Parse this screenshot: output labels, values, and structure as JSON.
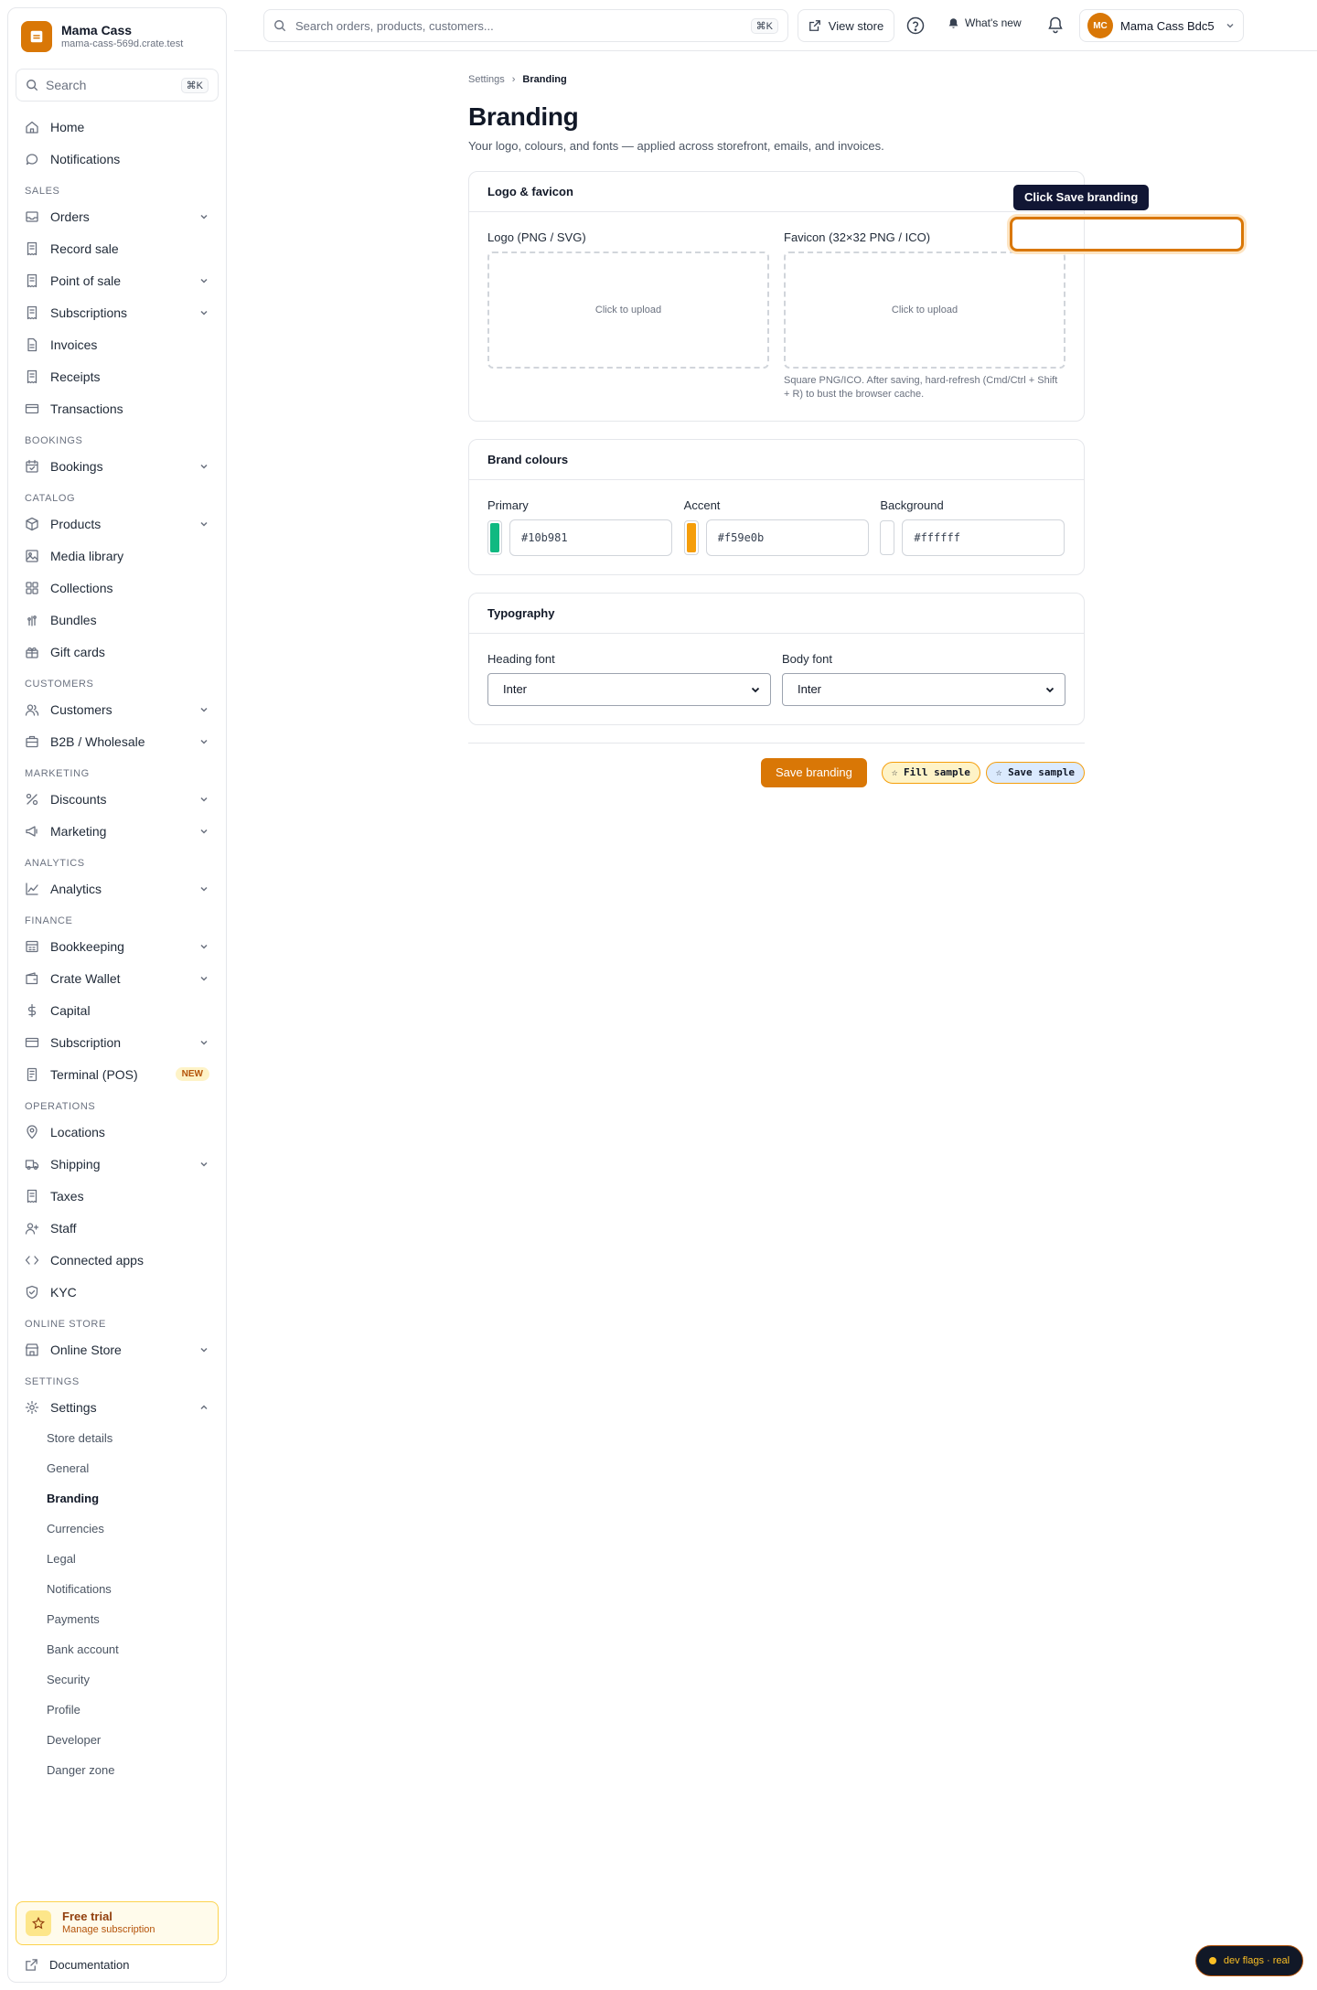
{
  "store": {
    "name": "Mama Cass",
    "domain": "mama-cass-569d.crate.test"
  },
  "sidebar": {
    "search_label": "Search",
    "search_shortcut": "⌘K",
    "top_items": [
      {
        "label": "Home",
        "icon": "home-icon"
      },
      {
        "label": "Notifications",
        "icon": "chat-bubble-icon"
      }
    ],
    "sections": [
      {
        "title": "SALES",
        "items": [
          {
            "label": "Orders",
            "icon": "inbox-icon",
            "expandable": true
          },
          {
            "label": "Record sale",
            "icon": "receipt-icon",
            "expandable": false
          },
          {
            "label": "Point of sale",
            "icon": "receipt-icon",
            "expandable": true
          },
          {
            "label": "Subscriptions",
            "icon": "receipt-icon",
            "expandable": true
          },
          {
            "label": "Invoices",
            "icon": "document-icon",
            "expandable": false
          },
          {
            "label": "Receipts",
            "icon": "receipt-icon",
            "expandable": false
          },
          {
            "label": "Transactions",
            "icon": "credit-card-icon",
            "expandable": false
          }
        ]
      },
      {
        "title": "BOOKINGS",
        "items": [
          {
            "label": "Bookings",
            "icon": "calendar-icon",
            "expandable": true
          }
        ]
      },
      {
        "title": "CATALOG",
        "items": [
          {
            "label": "Products",
            "icon": "box-icon",
            "expandable": true
          },
          {
            "label": "Media library",
            "icon": "image-icon",
            "expandable": false
          },
          {
            "label": "Collections",
            "icon": "grid-icon",
            "expandable": false
          },
          {
            "label": "Bundles",
            "icon": "layers-icon",
            "expandable": false
          },
          {
            "label": "Gift cards",
            "icon": "gift-icon",
            "expandable": false
          }
        ]
      },
      {
        "title": "CUSTOMERS",
        "items": [
          {
            "label": "Customers",
            "icon": "users-icon",
            "expandable": true
          },
          {
            "label": "B2B / Wholesale",
            "icon": "briefcase-icon",
            "expandable": true
          }
        ]
      },
      {
        "title": "MARKETING",
        "items": [
          {
            "label": "Discounts",
            "icon": "percent-icon",
            "expandable": true
          },
          {
            "label": "Marketing",
            "icon": "megaphone-icon",
            "expandable": true
          }
        ]
      },
      {
        "title": "ANALYTICS",
        "items": [
          {
            "label": "Analytics",
            "icon": "chart-line-icon",
            "expandable": true
          }
        ]
      },
      {
        "title": "FINANCE",
        "items": [
          {
            "label": "Bookkeeping",
            "icon": "book-icon",
            "expandable": true
          },
          {
            "label": "Crate Wallet",
            "icon": "wallet-icon",
            "expandable": true
          },
          {
            "label": "Capital",
            "icon": "dollar-icon",
            "expandable": false
          },
          {
            "label": "Subscription",
            "icon": "credit-card-icon",
            "expandable": true
          },
          {
            "label": "Terminal (POS)",
            "icon": "terminal-icon",
            "expandable": false,
            "badge": "NEW"
          }
        ]
      },
      {
        "title": "OPERATIONS",
        "items": [
          {
            "label": "Locations",
            "icon": "map-pin-icon",
            "expandable": false
          },
          {
            "label": "Shipping",
            "icon": "truck-icon",
            "expandable": true
          },
          {
            "label": "Taxes",
            "icon": "receipt-icon",
            "expandable": false
          },
          {
            "label": "Staff",
            "icon": "user-plus-icon",
            "expandable": false
          },
          {
            "label": "Connected apps",
            "icon": "code-icon",
            "expandable": false
          },
          {
            "label": "KYC",
            "icon": "shield-check-icon",
            "expandable": false
          }
        ]
      },
      {
        "title": "ONLINE STORE",
        "items": [
          {
            "label": "Online Store",
            "icon": "storefront-icon",
            "expandable": true
          }
        ]
      }
    ],
    "settings": {
      "title": "SETTINGS",
      "label": "Settings",
      "icon": "gear-icon",
      "sub_items": [
        {
          "label": "Store details",
          "active": false
        },
        {
          "label": "General",
          "active": false
        },
        {
          "label": "Branding",
          "active": true
        },
        {
          "label": "Currencies",
          "active": false
        },
        {
          "label": "Legal",
          "active": false
        },
        {
          "label": "Notifications",
          "active": false
        },
        {
          "label": "Payments",
          "active": false
        },
        {
          "label": "Bank account",
          "active": false
        },
        {
          "label": "Security",
          "active": false
        },
        {
          "label": "Profile",
          "active": false
        },
        {
          "label": "Developer",
          "active": false
        },
        {
          "label": "Danger zone",
          "active": false
        }
      ]
    },
    "trial": {
      "title": "Free trial",
      "subtitle": "Manage subscription"
    },
    "documentation": "Documentation"
  },
  "topbar": {
    "search_placeholder": "Search orders, products, customers...",
    "search_shortcut": "⌘K",
    "view_store": "View store",
    "whats_new": "What's new",
    "account_initials": "MC",
    "account_name": "Mama Cass Bdc5"
  },
  "page": {
    "breadcrumb": [
      "Settings",
      "Branding"
    ],
    "title": "Branding",
    "description": "Your logo, colours, and fonts — applied across storefront, emails, and invoices."
  },
  "logo_card": {
    "title": "Logo & favicon",
    "logo_label": "Logo (PNG / SVG)",
    "logo_upload": "Click to upload",
    "favicon_label": "Favicon (32×32 PNG / ICO)",
    "favicon_upload": "Click to upload",
    "favicon_hint": "Square PNG/ICO. After saving, hard-refresh (Cmd/Ctrl + Shift + R) to bust the browser cache."
  },
  "colours_card": {
    "title": "Brand colours",
    "colours": [
      {
        "label": "Primary",
        "value": "#10b981"
      },
      {
        "label": "Accent",
        "value": "#f59e0b"
      },
      {
        "label": "Background",
        "value": "#ffffff"
      }
    ]
  },
  "typography_card": {
    "title": "Typography",
    "heading_label": "Heading font",
    "heading_value": "Inter",
    "body_label": "Body font",
    "body_value": "Inter"
  },
  "actions": {
    "save": "Save branding",
    "fill_sample": "☆ Fill sample",
    "save_sample": "☆ Save sample"
  },
  "tutorial": {
    "tooltip": "Click Save branding"
  },
  "dev_flags": "dev flags · real",
  "colors": {
    "accent": "#d97706",
    "tooltip_bg": "#111634"
  }
}
